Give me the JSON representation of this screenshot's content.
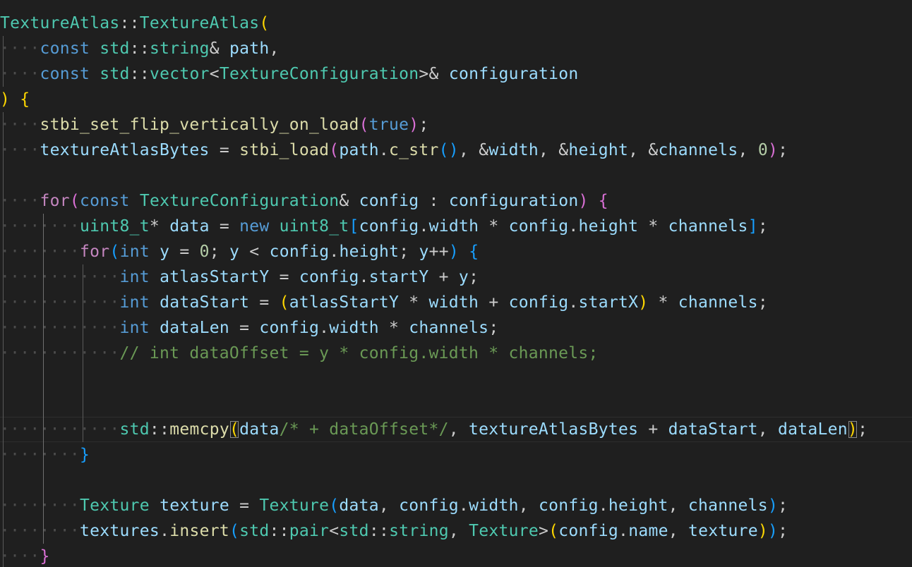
{
  "colors": {
    "background": "#1f1f1f",
    "keyword": "#569cd6",
    "control": "#c586c0",
    "type": "#4ec9b0",
    "function": "#dcdcaa",
    "variable": "#9cdcfe",
    "number": "#b5cea8",
    "comment": "#6a9955",
    "punctuation": "#cccccc",
    "bracket1": "#ffd700",
    "bracket2": "#da70d6",
    "bracket3": "#179fff",
    "whitespace": "#4c4c4c",
    "indent_guide": "#5a5a5a"
  },
  "editor": {
    "language": "cpp",
    "indent_size": 4,
    "show_whitespace": true,
    "current_line": 16,
    "lines": [
      [
        [
          "TextureAtlas",
          "t"
        ],
        [
          "::",
          "p"
        ],
        [
          "TextureAtlas",
          "t"
        ],
        [
          "(",
          "b1"
        ]
      ],
      [
        [
          "    ",
          "ws"
        ],
        [
          "const",
          "k"
        ],
        [
          " ",
          "p"
        ],
        [
          "std",
          "t"
        ],
        [
          "::",
          "p"
        ],
        [
          "string",
          "t"
        ],
        [
          "&",
          "p"
        ],
        [
          " ",
          "p"
        ],
        [
          "path",
          "v"
        ],
        [
          ",",
          "p"
        ]
      ],
      [
        [
          "    ",
          "ws"
        ],
        [
          "const",
          "k"
        ],
        [
          " ",
          "p"
        ],
        [
          "std",
          "t"
        ],
        [
          "::",
          "p"
        ],
        [
          "vector",
          "t"
        ],
        [
          "<",
          "p"
        ],
        [
          "TextureConfiguration",
          "t"
        ],
        [
          ">&",
          "p"
        ],
        [
          " ",
          "p"
        ],
        [
          "configuration",
          "v"
        ]
      ],
      [
        [
          ")",
          "b1"
        ],
        [
          " ",
          "p"
        ],
        [
          "{",
          "b1"
        ]
      ],
      [
        [
          "    ",
          "ws"
        ],
        [
          "stbi_set_flip_vertically_on_load",
          "f"
        ],
        [
          "(",
          "b2"
        ],
        [
          "true",
          "k"
        ],
        [
          ")",
          "b2"
        ],
        [
          ";",
          "p"
        ]
      ],
      [
        [
          "    ",
          "ws"
        ],
        [
          "textureAtlasBytes",
          "v"
        ],
        [
          " = ",
          "p"
        ],
        [
          "stbi_load",
          "f"
        ],
        [
          "(",
          "b2"
        ],
        [
          "path",
          "v"
        ],
        [
          ".",
          "p"
        ],
        [
          "c_str",
          "f"
        ],
        [
          "()",
          "b3"
        ],
        [
          ", &",
          "p"
        ],
        [
          "width",
          "v"
        ],
        [
          ", &",
          "p"
        ],
        [
          "height",
          "v"
        ],
        [
          ", &",
          "p"
        ],
        [
          "channels",
          "v"
        ],
        [
          ", ",
          "p"
        ],
        [
          "0",
          "n"
        ],
        [
          ")",
          "b2"
        ],
        [
          ";",
          "p"
        ]
      ],
      [],
      [
        [
          "    ",
          "ws"
        ],
        [
          "for",
          "c"
        ],
        [
          "(",
          "b2"
        ],
        [
          "const",
          "k"
        ],
        [
          " ",
          "p"
        ],
        [
          "TextureConfiguration",
          "t"
        ],
        [
          "&",
          "p"
        ],
        [
          " ",
          "p"
        ],
        [
          "config",
          "v"
        ],
        [
          " : ",
          "p"
        ],
        [
          "configuration",
          "v"
        ],
        [
          ")",
          "b2"
        ],
        [
          " ",
          "p"
        ],
        [
          "{",
          "b2"
        ]
      ],
      [
        [
          "        ",
          "ws"
        ],
        [
          "uint8_t",
          "t"
        ],
        [
          "*",
          "p"
        ],
        [
          " ",
          "p"
        ],
        [
          "data",
          "v"
        ],
        [
          " = ",
          "p"
        ],
        [
          "new",
          "k"
        ],
        [
          " ",
          "p"
        ],
        [
          "uint8_t",
          "t"
        ],
        [
          "[",
          "b3"
        ],
        [
          "config",
          "v"
        ],
        [
          ".",
          "p"
        ],
        [
          "width",
          "v"
        ],
        [
          " * ",
          "p"
        ],
        [
          "config",
          "v"
        ],
        [
          ".",
          "p"
        ],
        [
          "height",
          "v"
        ],
        [
          " * ",
          "p"
        ],
        [
          "channels",
          "v"
        ],
        [
          "]",
          "b3"
        ],
        [
          ";",
          "p"
        ]
      ],
      [
        [
          "        ",
          "ws"
        ],
        [
          "for",
          "c"
        ],
        [
          "(",
          "b3"
        ],
        [
          "int",
          "k"
        ],
        [
          " ",
          "p"
        ],
        [
          "y",
          "v"
        ],
        [
          " = ",
          "p"
        ],
        [
          "0",
          "n"
        ],
        [
          "; ",
          "p"
        ],
        [
          "y",
          "v"
        ],
        [
          " < ",
          "p"
        ],
        [
          "config",
          "v"
        ],
        [
          ".",
          "p"
        ],
        [
          "height",
          "v"
        ],
        [
          "; ",
          "p"
        ],
        [
          "y",
          "v"
        ],
        [
          "++",
          "p"
        ],
        [
          ")",
          "b3"
        ],
        [
          " ",
          "p"
        ],
        [
          "{",
          "b3"
        ]
      ],
      [
        [
          "            ",
          "ws"
        ],
        [
          "int",
          "k"
        ],
        [
          " ",
          "p"
        ],
        [
          "atlasStartY",
          "v"
        ],
        [
          " = ",
          "p"
        ],
        [
          "config",
          "v"
        ],
        [
          ".",
          "p"
        ],
        [
          "startY",
          "v"
        ],
        [
          " + ",
          "p"
        ],
        [
          "y",
          "v"
        ],
        [
          ";",
          "p"
        ]
      ],
      [
        [
          "            ",
          "ws"
        ],
        [
          "int",
          "k"
        ],
        [
          " ",
          "p"
        ],
        [
          "dataStart",
          "v"
        ],
        [
          " = ",
          "p"
        ],
        [
          "(",
          "b1"
        ],
        [
          "atlasStartY",
          "v"
        ],
        [
          " * ",
          "p"
        ],
        [
          "width",
          "v"
        ],
        [
          " + ",
          "p"
        ],
        [
          "config",
          "v"
        ],
        [
          ".",
          "p"
        ],
        [
          "startX",
          "v"
        ],
        [
          ")",
          "b1"
        ],
        [
          " * ",
          "p"
        ],
        [
          "channels",
          "v"
        ],
        [
          ";",
          "p"
        ]
      ],
      [
        [
          "            ",
          "ws"
        ],
        [
          "int",
          "k"
        ],
        [
          " ",
          "p"
        ],
        [
          "dataLen",
          "v"
        ],
        [
          " = ",
          "p"
        ],
        [
          "config",
          "v"
        ],
        [
          ".",
          "p"
        ],
        [
          "width",
          "v"
        ],
        [
          " * ",
          "p"
        ],
        [
          "channels",
          "v"
        ],
        [
          ";",
          "p"
        ]
      ],
      [
        [
          "            ",
          "ws"
        ],
        [
          "// int dataOffset = y * config.width * channels;",
          "cm"
        ]
      ],
      [],
      [],
      [
        [
          "            ",
          "ws"
        ],
        [
          "std",
          "t"
        ],
        [
          "::",
          "p"
        ],
        [
          "memcpy",
          "f"
        ],
        [
          "(",
          "b1m"
        ],
        [
          "data",
          "v"
        ],
        [
          "/* + dataOffset*/",
          "cm"
        ],
        [
          ", ",
          "p"
        ],
        [
          "textureAtlasBytes",
          "v"
        ],
        [
          " + ",
          "p"
        ],
        [
          "dataStart",
          "v"
        ],
        [
          ", ",
          "p"
        ],
        [
          "dataLen",
          "v"
        ],
        [
          ")",
          "b1m"
        ],
        [
          ";",
          "p"
        ]
      ],
      [
        [
          "        ",
          "ws"
        ],
        [
          "}",
          "b3"
        ]
      ],
      [],
      [
        [
          "        ",
          "ws"
        ],
        [
          "Texture",
          "t"
        ],
        [
          " ",
          "p"
        ],
        [
          "texture",
          "v"
        ],
        [
          " = ",
          "p"
        ],
        [
          "Texture",
          "t"
        ],
        [
          "(",
          "b3"
        ],
        [
          "data",
          "v"
        ],
        [
          ", ",
          "p"
        ],
        [
          "config",
          "v"
        ],
        [
          ".",
          "p"
        ],
        [
          "width",
          "v"
        ],
        [
          ", ",
          "p"
        ],
        [
          "config",
          "v"
        ],
        [
          ".",
          "p"
        ],
        [
          "height",
          "v"
        ],
        [
          ", ",
          "p"
        ],
        [
          "channels",
          "v"
        ],
        [
          ")",
          "b3"
        ],
        [
          ";",
          "p"
        ]
      ],
      [
        [
          "        ",
          "ws"
        ],
        [
          "textures",
          "v"
        ],
        [
          ".",
          "p"
        ],
        [
          "insert",
          "f"
        ],
        [
          "(",
          "b3"
        ],
        [
          "std",
          "t"
        ],
        [
          "::",
          "p"
        ],
        [
          "pair",
          "t"
        ],
        [
          "<",
          "p"
        ],
        [
          "std",
          "t"
        ],
        [
          "::",
          "p"
        ],
        [
          "string",
          "t"
        ],
        [
          ", ",
          "p"
        ],
        [
          "Texture",
          "t"
        ],
        [
          ">",
          "p"
        ],
        [
          "(",
          "b1"
        ],
        [
          "config",
          "v"
        ],
        [
          ".",
          "p"
        ],
        [
          "name",
          "v"
        ],
        [
          ", ",
          "p"
        ],
        [
          "texture",
          "v"
        ],
        [
          ")",
          "b1"
        ],
        [
          ")",
          "b3"
        ],
        [
          ";",
          "p"
        ]
      ],
      [
        [
          "    ",
          "ws"
        ],
        [
          "}",
          "b2"
        ]
      ],
      [
        [
          "}",
          "b1"
        ]
      ]
    ]
  }
}
